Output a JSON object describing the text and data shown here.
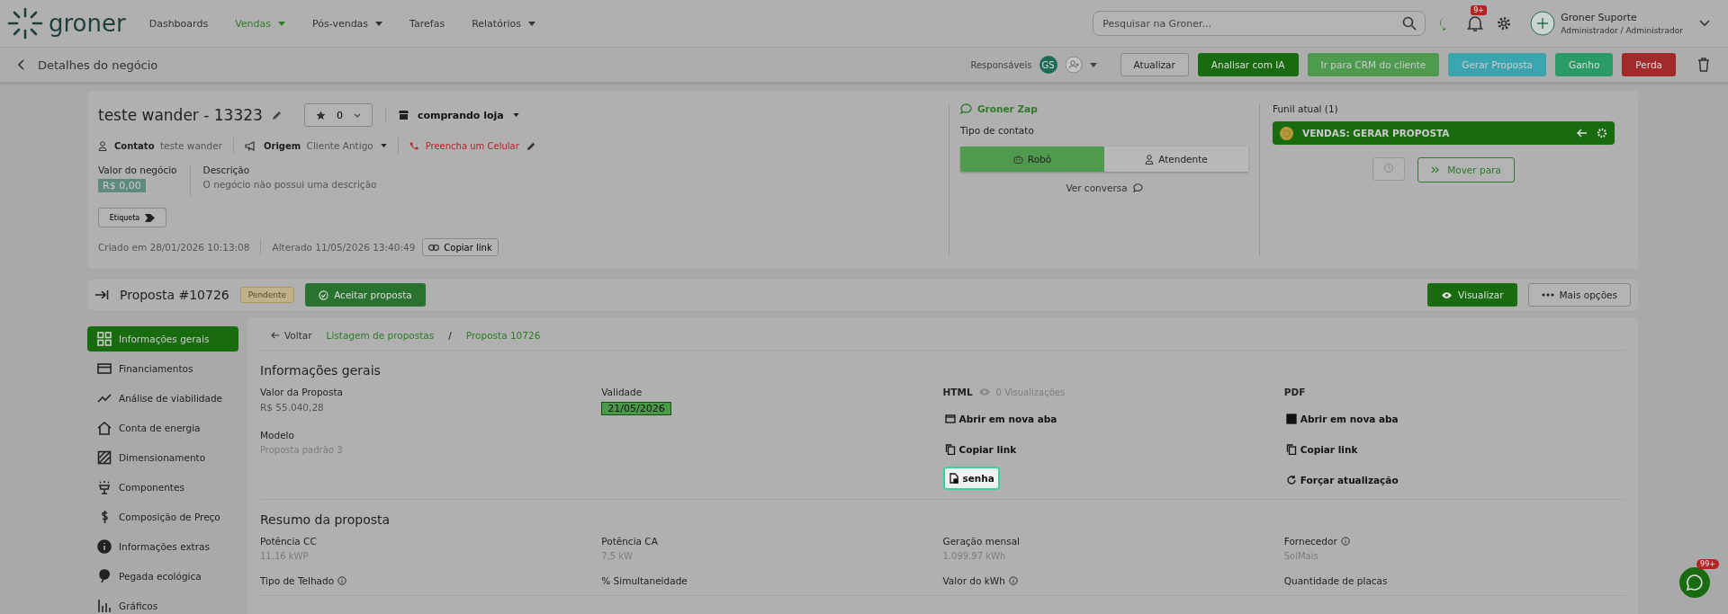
{
  "topbar": {
    "logo": "groner",
    "nav": [
      {
        "label": "Dashboards",
        "selected": false,
        "dropdown": false
      },
      {
        "label": "Vendas",
        "selected": true,
        "dropdown": true
      },
      {
        "label": "Pós-vendas",
        "selected": false,
        "dropdown": true
      },
      {
        "label": "Tarefas",
        "selected": false,
        "dropdown": false
      },
      {
        "label": "Relatórios",
        "selected": false,
        "dropdown": true
      }
    ],
    "search": {
      "placeholder": "Pesquisar na Groner..."
    },
    "notifications_badge": "9+",
    "user": {
      "name": "Groner Suporte",
      "role": "Administrador / Administrador"
    }
  },
  "page_header": {
    "title": "Detalhes do negócio",
    "responsaveis_label": "Responsáveis",
    "avatar_initials": "GS",
    "actions": [
      {
        "label": "Atualizar",
        "kind": "outline"
      },
      {
        "label": "Analisar com IA",
        "kind": "dark"
      },
      {
        "label": "Ir para CRM do cliente",
        "kind": "light"
      },
      {
        "label": "Gerar Proposta",
        "kind": "teal"
      },
      {
        "label": "Ganho",
        "kind": "success"
      },
      {
        "label": "Perda",
        "kind": "danger"
      }
    ]
  },
  "deal": {
    "title": "teste wander - 13323",
    "rating": "0",
    "category": "comprando loja",
    "contact_label": "Contato",
    "contact": "teste wander",
    "origin_label": "Origem",
    "origin": "Cliente Antigo",
    "phone_prompt": "Preencha um Celular",
    "value_label": "Valor do negócio",
    "value": "R$ 0,00",
    "description_label": "Descrição",
    "description": "O negócio não possui uma descrição",
    "tag_button": "Etiqueta",
    "created": "Criado em 28/01/2026 10:13:08",
    "modified": "Alterado 11/05/2026 13:40:49",
    "copy_link": "Copiar link"
  },
  "zap": {
    "title": "Groner Zap",
    "contact_type_label": "Tipo de contato",
    "options": [
      {
        "label": "Robô",
        "selected": true
      },
      {
        "label": "Atendente",
        "selected": false
      }
    ],
    "view_chat": "Ver conversa"
  },
  "funnel": {
    "title": "Funil atual (1)",
    "stage": "VENDAS: GERAR PROPOSTA",
    "move": "Mover para"
  },
  "proposal": {
    "title": "Proposta #10726",
    "status": "Pendente",
    "accept": "Aceitar proposta",
    "view": "Visualizar",
    "more": "Mais opções",
    "sidebar": [
      {
        "label": "Informações gerais",
        "selected": true
      },
      {
        "label": "Financiamentos",
        "selected": false
      },
      {
        "label": "Análise de viabilidade",
        "selected": false
      },
      {
        "label": "Conta de energia",
        "selected": false
      },
      {
        "label": "Dimensionamento",
        "selected": false
      },
      {
        "label": "Componentes",
        "selected": false
      },
      {
        "label": "Composição de Preço",
        "selected": false
      },
      {
        "label": "Informações extras",
        "selected": false
      },
      {
        "label": "Pegada ecológica",
        "selected": false
      },
      {
        "label": "Gráficos",
        "selected": false
      }
    ],
    "breadcrumb": {
      "back": "Voltar",
      "separator": "/",
      "items": [
        "Listagem de propostas",
        "Proposta 10726"
      ]
    },
    "general": {
      "heading": "Informações gerais",
      "value_label": "Valor da Proposta",
      "value": "R$ 55.040,28",
      "validity_label": "Validade",
      "validity": "21/05/2026",
      "model_label": "Modelo",
      "model": "Proposta padrão 3",
      "html": {
        "label": "HTML",
        "views": "0 Visualizações",
        "links": [
          {
            "label": "Abrir em nova aba",
            "highlighted": false
          },
          {
            "label": "Copiar link",
            "highlighted": false
          },
          {
            "label": "senha",
            "highlighted": true
          }
        ]
      },
      "pdf": {
        "label": "PDF",
        "links": [
          {
            "label": "Abrir em nova aba",
            "highlighted": false
          },
          {
            "label": "Copiar link",
            "highlighted": false
          },
          {
            "label": "Forçar atualização",
            "highlighted": false
          }
        ]
      }
    },
    "summary": {
      "heading": "Resumo da proposta",
      "fields": [
        {
          "label": "Potência CC",
          "value": "11,16 kWP",
          "info": false
        },
        {
          "label": "Potência CA",
          "value": "7,5 kW",
          "info": false
        },
        {
          "label": "Geração mensal",
          "value": "1.099,97 kWh",
          "info": false
        },
        {
          "label": "Fornecedor",
          "value": "SolMais",
          "info": true
        },
        {
          "label": "Tipo de Telhado",
          "info": true
        },
        {
          "label": "% Simultaneidade",
          "info": false
        },
        {
          "label": "Valor do kWh",
          "info": true
        },
        {
          "label": "Quantidade de placas",
          "info": false
        }
      ]
    }
  },
  "chat_badge": "99+"
}
